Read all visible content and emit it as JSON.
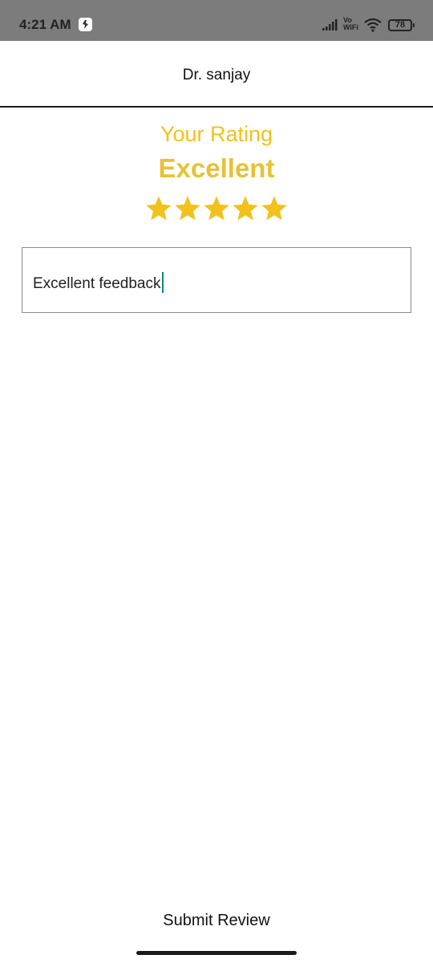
{
  "status_bar": {
    "time": "4:21 AM",
    "network_label_top": "Vo",
    "network_label_bottom": "WiFi",
    "battery": "78",
    "icons": [
      "notification-icon",
      "signal-icon",
      "vowifi-icon",
      "wifi-icon",
      "battery-icon"
    ]
  },
  "header": {
    "title": "Dr. sanjay"
  },
  "rating": {
    "heading": "Your Rating",
    "value_label": "Excellent",
    "stars_filled": 5,
    "stars_total": 5,
    "star_color": "#f1c21b"
  },
  "feedback": {
    "value": "Excellent feedback",
    "caret_color": "#0e8a7a"
  },
  "actions": {
    "submit_label": "Submit Review"
  },
  "colors": {
    "status_bar": "#7c7c7c",
    "heading_yellow": "#f1c21b",
    "value_yellow": "#e6c235"
  }
}
